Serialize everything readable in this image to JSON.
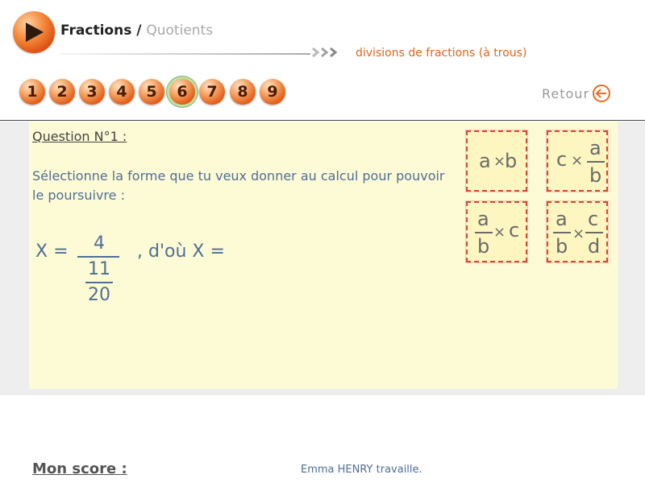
{
  "header": {
    "title": "Fractions",
    "separator": "/",
    "subtitle": "Quotients",
    "section": "divisions de fractions (à trous)",
    "retour_label": "Retour"
  },
  "question_nav": {
    "items": [
      "1",
      "2",
      "3",
      "4",
      "5",
      "6",
      "7",
      "8",
      "9"
    ],
    "active": "6"
  },
  "question": {
    "label": "Question N°1 :",
    "prompt": "Sélectionne la forme que tu veux donner au calcul pour pouvoir le poursuivre :",
    "expression": {
      "lhs": "X =",
      "numerator": "4",
      "denominator_numerator": "11",
      "denominator_denominator": "20",
      "tail": ", d'où X ="
    }
  },
  "choices": {
    "ab": {
      "a": "a",
      "times": "×",
      "b": "b"
    },
    "c_a_over_b": {
      "c": "c",
      "times": "×",
      "a": "a",
      "b": "b"
    },
    "a_over_b_c": {
      "a": "a",
      "b": "b",
      "times": "×",
      "c": "c"
    },
    "a_over_b_c_over_d": {
      "a": "a",
      "b": "b",
      "times": "×",
      "c": "c",
      "d": "d"
    }
  },
  "footer": {
    "score_label": "Mon score :",
    "status": "Emma HENRY travaille."
  },
  "colors": {
    "accent_orange": "#e0661c",
    "panel_yellow": "#fdfbd6",
    "text_blue": "#4f6e97",
    "choice_border": "#d9463a"
  },
  "icons": {
    "logo": "play-arrow-icon",
    "nav_chevrons": "chevron-triple-right-icon",
    "retour": "arrow-left-circle-icon"
  }
}
